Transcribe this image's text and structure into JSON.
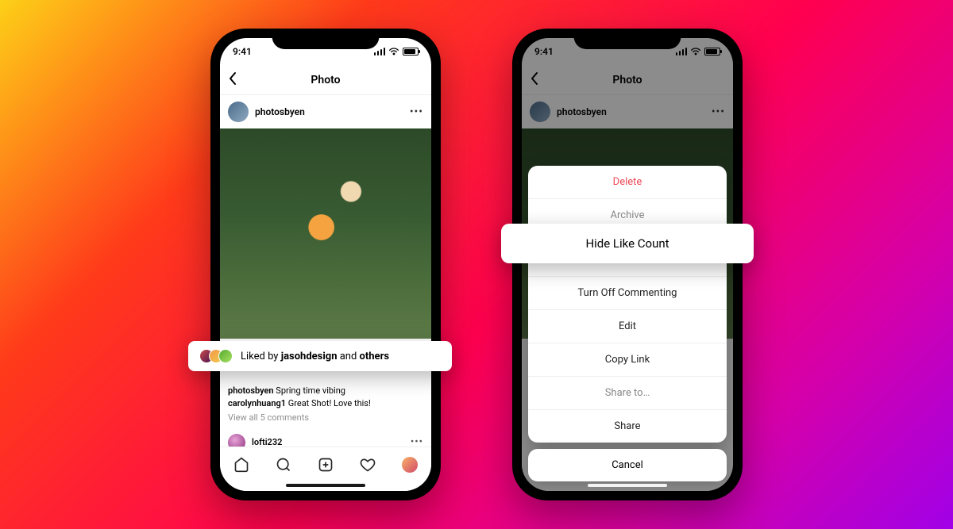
{
  "status": {
    "time": "9:41"
  },
  "nav": {
    "title": "Photo"
  },
  "post": {
    "username": "photosbyen",
    "liked_by_prefix": "Liked by ",
    "liked_by_user": "jasohdesign",
    "liked_by_middle": " and ",
    "liked_by_suffix": "others",
    "caption_user": "photosbyen",
    "caption_text": " Spring time vibing",
    "comment_user": "carolynhuang1",
    "comment_text": " Great Shot! Love this!",
    "view_all": "View all 5 comments",
    "comment_input_user": "lofti232"
  },
  "sheet": {
    "delete": "Delete",
    "archive": "Archive",
    "hide_like": "Hide Like Count",
    "turn_off_commenting": "Turn Off Commenting",
    "edit": "Edit",
    "copy_link": "Copy Link",
    "share_to": "Share to…",
    "share": "Share",
    "cancel": "Cancel"
  }
}
